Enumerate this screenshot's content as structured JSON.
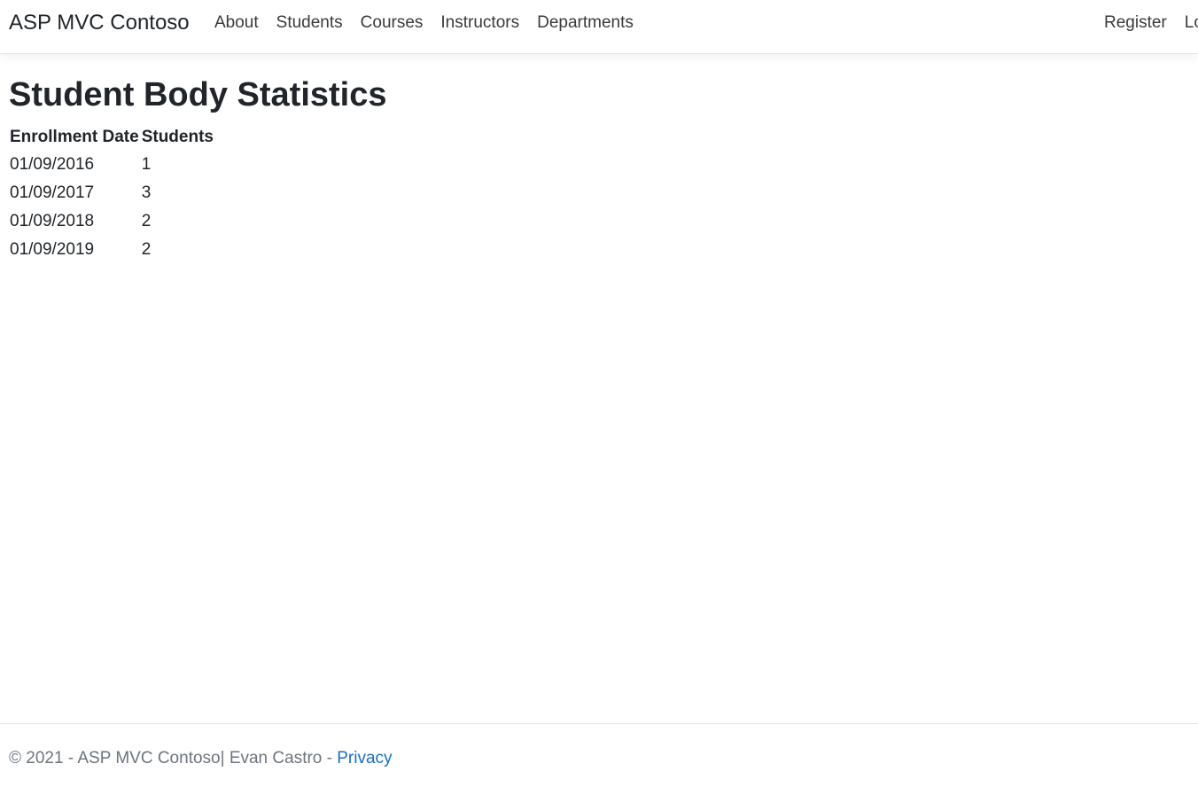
{
  "navbar": {
    "brand": "ASP MVC Contoso",
    "links": [
      "About",
      "Students",
      "Courses",
      "Instructors",
      "Departments"
    ],
    "right_links": [
      "Register",
      "Login"
    ]
  },
  "main": {
    "title": "Student Body Statistics",
    "table": {
      "headers": [
        "Enrollment Date",
        "Students"
      ],
      "rows": [
        {
          "date": "01/09/2016",
          "count": "1"
        },
        {
          "date": "01/09/2017",
          "count": "3"
        },
        {
          "date": "01/09/2018",
          "count": "2"
        },
        {
          "date": "01/09/2019",
          "count": "2"
        }
      ]
    }
  },
  "footer": {
    "text": "© 2021 - ASP MVC Contoso| Evan Castro - ",
    "privacy": "Privacy"
  },
  "colors": {
    "link": "#1b6ec2",
    "muted": "#6c757d",
    "text": "#212529"
  }
}
